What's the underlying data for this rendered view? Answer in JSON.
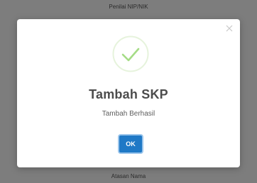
{
  "background": {
    "top_label": "Penilai NIP/NIK",
    "bottom_label": "Atasan Nama"
  },
  "dialog": {
    "title": "Tambah SKP",
    "message": "Tambah Berhasil",
    "ok_label": "OK",
    "icons": {
      "status": "success-check-icon",
      "close": "close-icon"
    },
    "colors": {
      "success": "#a5dc86",
      "button": "#1f79c6",
      "overlay": "#7d7d7d"
    }
  }
}
